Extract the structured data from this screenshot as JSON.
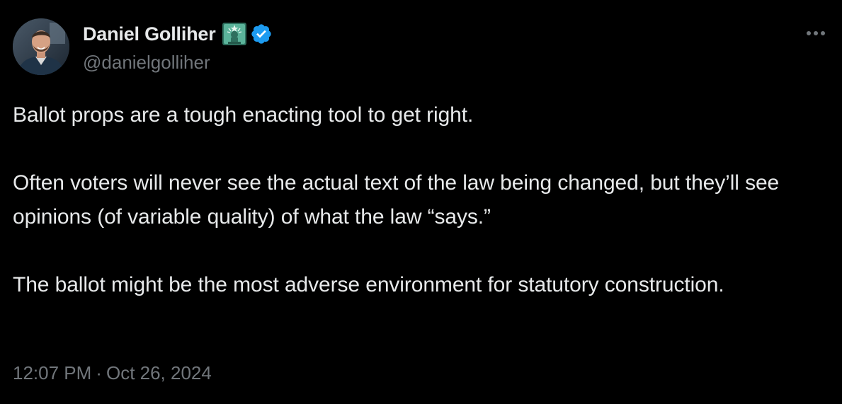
{
  "author": {
    "display_name": "Daniel Golliher",
    "handle": "@danielgolliher",
    "affiliation_badge_icon": "statue-of-liberty-badge-icon",
    "verified_icon": "verified-badge-icon",
    "verified_color": "#1d9bf0"
  },
  "tweet": {
    "text": "Ballot props are a tough enacting tool to get right.\n\nOften voters will never see the actual text of the law being changed, but they’ll see opinions (of variable quality) of what the law “says.”\n\nThe ballot might be the most adverse environment for statutory construction.",
    "time": "12:07 PM",
    "separator": "·",
    "date": "Oct 26, 2024"
  },
  "actions": {
    "more_icon": "more-options-icon"
  },
  "colors": {
    "background": "#000000",
    "primary_text": "#e7e9ea",
    "secondary_text": "#71767b",
    "badge_green": "#5bb39a"
  }
}
